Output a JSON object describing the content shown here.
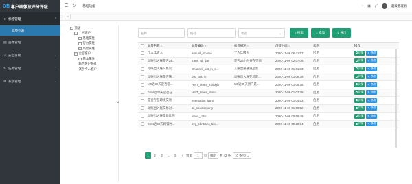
{
  "brand": {
    "mark": "GB",
    "name": "客户画像及评分评级"
  },
  "sidebar": {
    "groups": [
      {
        "label": "标签管理",
        "open": true
      },
      {
        "label": "画像管理"
      },
      {
        "label": "安全分级"
      },
      {
        "label": "任务管理"
      },
      {
        "label": "系统管理"
      }
    ],
    "active_sub": "标签列表"
  },
  "header": {
    "page_tab": "基础功能",
    "username": "超级管理员"
  },
  "tree": [
    {
      "label": "顶级",
      "level": 0,
      "toggle": "−"
    },
    {
      "label": "个人客户",
      "level": 1,
      "toggle": "−"
    },
    {
      "label": "基础属性",
      "level": 2,
      "toggle": "+"
    },
    {
      "label": "行为属性",
      "level": 2,
      "toggle": "+"
    },
    {
      "label": "风险属性",
      "level": 2,
      "toggle": "+"
    },
    {
      "label": "企业客户",
      "level": 1,
      "toggle": "−"
    },
    {
      "label": "基本属性",
      "level": 2,
      "toggle": "+"
    },
    {
      "label": "临时客户Test",
      "level": 1,
      "toggle": ""
    },
    {
      "label": "演示个人客户",
      "level": 1,
      "toggle": ""
    }
  ],
  "filters": {
    "name_placeholder": "名称",
    "code_placeholder": "编号",
    "status_placeholder": "状态",
    "search_label": "搜索",
    "add_label": "添加",
    "export_label": "导出"
  },
  "table": {
    "columns": [
      "标签名称",
      "标签编码",
      "标签描述",
      "创建时间",
      "状态",
      "操作"
    ],
    "rows": [
      {
        "name": "个人年收入",
        "code": "annual_income",
        "desc": "个人年收入",
        "time": "2020-11-06 06:41:57",
        "status": "启用"
      },
      {
        "name": "动账出入账是否24...",
        "code": "trans_all_day",
        "desc": "是否24小时存在交易",
        "time": "2020-11-09 02:07:06",
        "status": "启用"
      },
      {
        "name": "动账出入账交易渠...",
        "code": "Channel_out_in_s...",
        "desc": "入账出账通道是否...",
        "time": "2020-11-09 01:01:33",
        "status": "启用"
      },
      {
        "name": "动账出入账是否快...",
        "code": "fast_out_in",
        "desc": "动账出入账交易是...",
        "time": "2020-11-09 01:09:38",
        "status": "启用"
      },
      {
        "name": "M8近30天是否临...",
        "code": "HMT_times_mblogin",
        "desc": "M8近30天用户是...",
        "time": "2020-11-09 01:08:38",
        "status": "启用"
      },
      {
        "name": "EBN近30天是否在...",
        "code": "HMT_times_ebnlo...",
        "desc": "",
        "time": "2020-11-09 01:07:29",
        "status": "启用"
      },
      {
        "name": "是否存在跨境交易",
        "code": "internation_trans",
        "desc": "",
        "time": "2020-11-09 01:04:53",
        "status": "启用"
      },
      {
        "name": "动账出入账交易对...",
        "code": "all_counterparty",
        "desc": "",
        "time": "2020-11-09 01:00:52",
        "status": "启用"
      },
      {
        "name": "动账出入账交易比例",
        "code": "times_ratio",
        "desc": "",
        "time": "2020-11-09 00:59:49",
        "status": "启用"
      },
      {
        "name": "EBN近30天网银时...",
        "code": "avg_ebntrans_tim...",
        "desc": "",
        "time": "2020-11-09 00:20:54",
        "status": "启用"
      }
    ],
    "detail_label": "详情",
    "edit_label": "修改"
  },
  "pagination": {
    "prev": "‹",
    "pages": [
      "1",
      "2",
      "3",
      "...",
      "5"
    ],
    "active": "1",
    "next": "›",
    "goto_label": "到第",
    "page_input": "1",
    "page_unit": "页",
    "confirm": "确定",
    "total": "共 42 条",
    "page_size": "10 条/页"
  }
}
